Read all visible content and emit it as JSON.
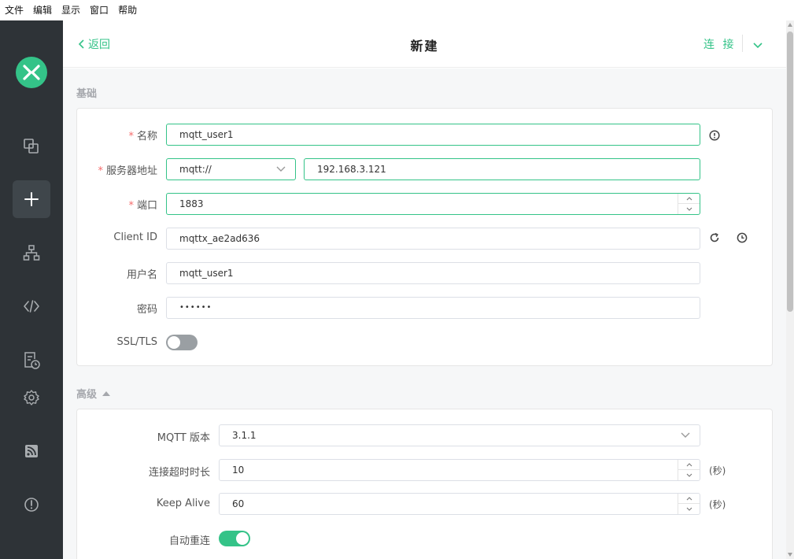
{
  "menu": [
    "文件",
    "编辑",
    "显示",
    "窗口",
    "帮助"
  ],
  "header": {
    "back_label": "返回",
    "title": "新建",
    "connect_label": "连 接"
  },
  "basic": {
    "section_title": "基础",
    "name": {
      "label": "名称",
      "value": "mqtt_user1"
    },
    "server": {
      "label": "服务器地址",
      "protocol": "mqtt://",
      "host": "192.168.3.121"
    },
    "port": {
      "label": "端口",
      "value": "1883"
    },
    "client_id": {
      "label": "Client ID",
      "value": "mqttx_ae2ad636"
    },
    "username": {
      "label": "用户名",
      "value": "mqtt_user1"
    },
    "password": {
      "label": "密码",
      "value": "••••••"
    },
    "ssl": {
      "label": "SSL/TLS",
      "enabled": false
    }
  },
  "advanced": {
    "section_title": "高级",
    "mqtt_version": {
      "label": "MQTT 版本",
      "value": "3.1.1"
    },
    "connect_timeout": {
      "label": "连接超时时长",
      "value": "10",
      "unit": "(秒)"
    },
    "keep_alive": {
      "label": "Keep Alive",
      "value": "60",
      "unit": "(秒)"
    },
    "auto_reconnect": {
      "label": "自动重连",
      "enabled": true
    }
  },
  "colors": {
    "accent": "#34c388",
    "sidebar": "#2e3337",
    "required": "#f56c6c"
  },
  "icons": {
    "sidebar": [
      "connections-icon",
      "new-connection-icon",
      "topology-icon",
      "script-icon",
      "log-icon",
      "settings-icon",
      "feed-icon",
      "about-icon"
    ]
  }
}
